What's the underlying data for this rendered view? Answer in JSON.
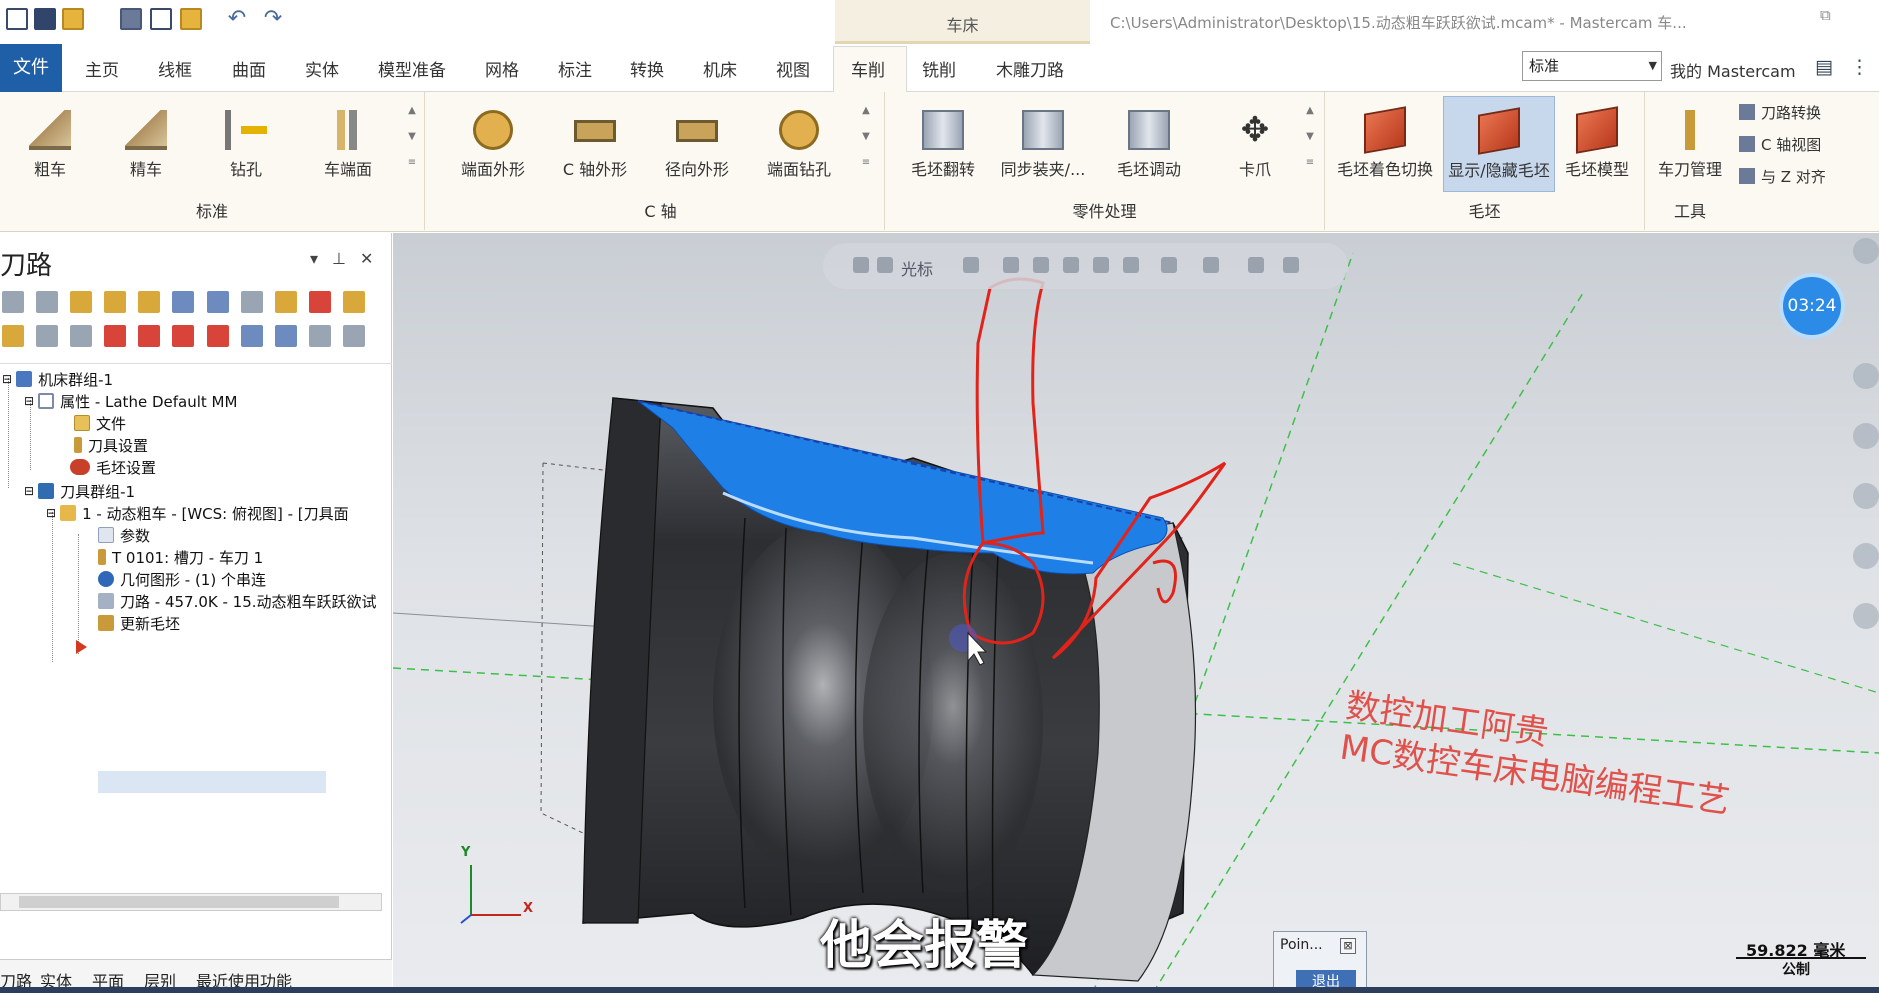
{
  "titlebar": {
    "context_tab": "车床",
    "window_title": "C:\\Users\\Administrator\\Desktop\\15.动态粗车跃跃欲试.mcam* - Mastercam 车..."
  },
  "tabs": {
    "file": "文件",
    "items": [
      "主页",
      "线框",
      "曲面",
      "实体",
      "模型准备",
      "网格",
      "标注",
      "转换",
      "机床",
      "视图",
      "车削",
      "铣削",
      "木雕刀路"
    ],
    "active": "车削",
    "style_combo": "标准",
    "my_mastercam": "我的 Mastercam"
  },
  "ribbon": {
    "groups": {
      "standard": {
        "label": "标准",
        "buttons": [
          "粗车",
          "精车",
          "钻孔",
          "车端面"
        ]
      },
      "c_axis": {
        "label": "C 轴",
        "buttons": [
          "端面外形",
          "C 轴外形",
          "径向外形",
          "端面钻孔"
        ]
      },
      "part_handling": {
        "label": "零件处理",
        "buttons": [
          "毛坯翻转",
          "同步装夹/...",
          "毛坯调动",
          "卡爪"
        ]
      },
      "stock": {
        "label": "毛坯",
        "buttons": [
          "毛坯着色切换",
          "显示/隐藏毛坯",
          "毛坯模型"
        ]
      },
      "tools": {
        "label": "工具",
        "buttons": [
          "车刀管理"
        ],
        "small": [
          "刀路转换",
          "C 轴视图",
          "与 Z 对齐"
        ]
      }
    }
  },
  "panel": {
    "title": "刀路",
    "tree": {
      "machine_group": "机床群组-1",
      "properties": "属性 - Lathe Default MM",
      "files": "文件",
      "tool_settings": "刀具设置",
      "stock_settings": "毛坯设置",
      "toolpath_group": "刀具群组-1",
      "operation": "1 - 动态粗车 - [WCS: 俯视图] - [刀具面",
      "parameters": "参数",
      "tool": "T 0101: 槽刀 - 车刀 1",
      "geometry": "几何图形 - (1) 个串连",
      "toolpath": "刀路 - 457.0K - 15.动态粗车跃跃欲试",
      "update_stock": "更新毛坯"
    },
    "bottom_tabs": [
      "刀路",
      "实体",
      "平面",
      "层别",
      "最近使用功能"
    ]
  },
  "viewport": {
    "toolbar_label": "光标",
    "timer": "03:24",
    "watermark_line1": "数控加工阿贵",
    "watermark_line2": "MC数控车床电脑编程工艺",
    "subtitle": "他会报警",
    "axis_x": "X",
    "axis_y": "Y",
    "scale_value": "59.822 毫米",
    "scale_unit": "公制"
  },
  "point_dialog": {
    "title": "Poin...",
    "close": "⊠",
    "exit": "退出"
  },
  "colors": {
    "file_tab": "#1e5fa8",
    "ribbon_bg": "#fbf9f2",
    "annotation_red": "#e0413a",
    "toolpath_blue": "#1e7fe6",
    "timer": "#2b8be6"
  }
}
